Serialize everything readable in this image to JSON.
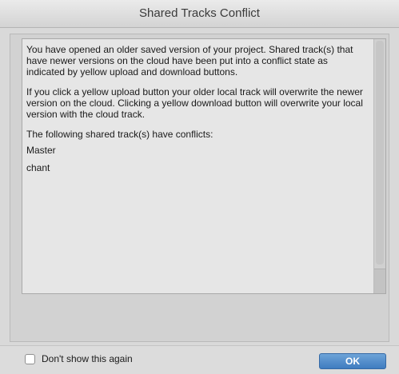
{
  "window": {
    "title": "Shared Tracks Conflict"
  },
  "message": {
    "paragraph1": "You have opened an older saved version of your project. Shared track(s) that have newer versions on the cloud have been put into a conflict state as indicated by yellow upload and download buttons.",
    "paragraph2": "If you click a yellow upload button your older local track will overwrite the newer version on the cloud. Clicking a yellow download button will overwrite your local version with the cloud track.",
    "paragraph3": "The following shared track(s) have conflicts:",
    "tracks": [
      "Master",
      "chant"
    ]
  },
  "footer": {
    "checkbox_label": "Don't show this again",
    "checkbox_checked": false,
    "ok_label": "OK"
  },
  "colors": {
    "ok_button": "#4a86c8"
  }
}
